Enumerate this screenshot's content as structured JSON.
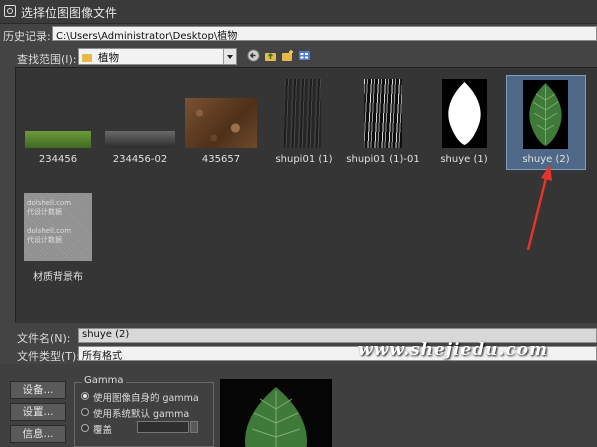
{
  "window": {
    "title": "选择位图图像文件"
  },
  "history": {
    "label": "历史记录:",
    "path": "C:\\Users\\Administrator\\Desktop\\植物"
  },
  "look_in": {
    "label": "查找范围(I):",
    "folder": "植物"
  },
  "toolbar": {
    "back_icon": "back-icon",
    "up_icon": "up-folder-icon",
    "new_folder_icon": "new-folder-icon",
    "view_icon": "view-menu-icon"
  },
  "files": [
    {
      "name": "234456",
      "kind": "green-strip"
    },
    {
      "name": "234456-02",
      "kind": "dark-strip"
    },
    {
      "name": "435657",
      "kind": "soil"
    },
    {
      "name": "shupi01 (1)",
      "kind": "bark"
    },
    {
      "name": "shupi01 (1)-01",
      "kind": "bark-bw"
    },
    {
      "name": "shuye (1)",
      "kind": "leaf-mask"
    },
    {
      "name": "shuye (2)",
      "kind": "leaf",
      "selected": true
    },
    {
      "name": "材质背景布",
      "kind": "cloth",
      "watermark": [
        "dolshell.com",
        "代设计数据",
        "dolshell.com",
        "代设计数据"
      ]
    }
  ],
  "file_name": {
    "label": "文件名(N):",
    "value": "shuye (2)"
  },
  "file_type": {
    "label": "文件类型(T):",
    "value": "所有格式"
  },
  "buttons": {
    "setup": "设备...",
    "settings": "设置...",
    "info": "信息..."
  },
  "gamma": {
    "title": "Gamma",
    "options": [
      "使用图像自身的 gamma",
      "使用系统默认 gamma",
      "覆盖"
    ],
    "selected_index": 0
  },
  "watermark": "www.shejiedu.com",
  "colors": {
    "selection": "#4f6887",
    "arrow": "#e8322c",
    "leaf": "#3f7a3a"
  }
}
